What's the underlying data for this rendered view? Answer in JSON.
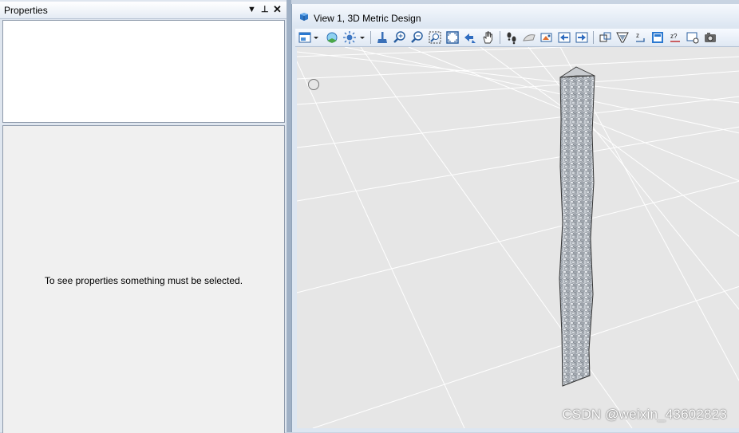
{
  "properties_panel": {
    "title": "Properties",
    "dropdown_icon": "triangle-down-icon",
    "pin_icon": "pin-icon",
    "close_icon": "close-x-icon",
    "pin_glyph": "⊥",
    "close_glyph": "✕",
    "dropdown_glyph": "▼",
    "empty_message": "To see properties something must be selected."
  },
  "view_window": {
    "title": "View 1, 3D Metric Design",
    "title_icon": "view-cube-icon",
    "toolbar_icons": [
      "view-attributes-icon",
      "view-attributes-dropdown-icon",
      "display-style-icon",
      "lighting-icon",
      "lighting-dropdown-icon",
      "update-view-icon",
      "zoom-in-icon",
      "zoom-out-icon",
      "window-area-icon",
      "fit-view-icon",
      "rotate-view-icon",
      "pan-view-icon",
      "walk-icon",
      "look-icon",
      "camera-icon",
      "previous-view-icon",
      "next-view-icon",
      "view-rotation-icon",
      "clip-volume-icon",
      "change-view-perspective-icon",
      "view-properties-icon",
      "display-depth-icon",
      "active-depth-icon",
      "save-view-icon"
    ]
  },
  "watermark": "CSDN @weixin_43602823",
  "colors": {
    "panel_background": "#dfe6ef",
    "viewport_background": "#e6e6e6",
    "grid_line": "#ffffff",
    "column_texture": "#b8bcc2"
  }
}
